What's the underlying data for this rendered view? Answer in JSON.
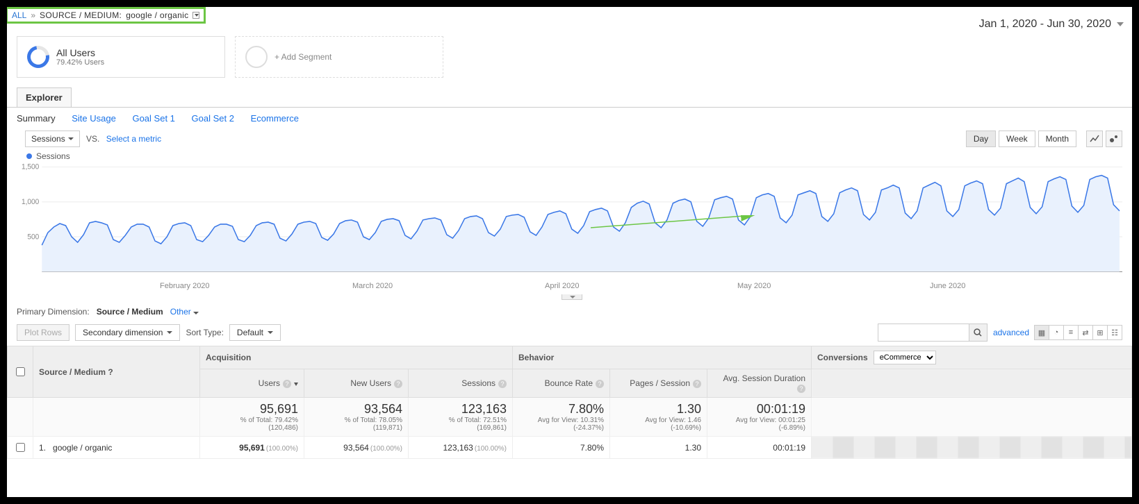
{
  "breadcrumb": {
    "all": "ALL",
    "label": "SOURCE / MEDIUM:",
    "value": "google / organic"
  },
  "dateRange": "Jan 1, 2020 - Jun 30, 2020",
  "segments": {
    "primary": {
      "title": "All Users",
      "sub": "79.42% Users"
    },
    "add": "+ Add Segment"
  },
  "tabs": {
    "explorer": "Explorer"
  },
  "subtabs": {
    "summary": "Summary",
    "siteUsage": "Site Usage",
    "goal1": "Goal Set 1",
    "goal2": "Goal Set 2",
    "ecom": "Ecommerce"
  },
  "chartBar": {
    "metric": "Sessions",
    "vs": "VS.",
    "selectMetric": "Select a metric",
    "day": "Day",
    "week": "Week",
    "month": "Month"
  },
  "chartLegend": "Sessions",
  "chart_data": {
    "type": "line",
    "title": "Sessions",
    "ylabel": "",
    "xlabel": "",
    "ylim": [
      0,
      1500
    ],
    "yticks": [
      500,
      1000,
      1500
    ],
    "xticks": [
      "February 2020",
      "March 2020",
      "April 2020",
      "May 2020",
      "June 2020"
    ],
    "series": [
      {
        "name": "Sessions",
        "color": "#3b78e7",
        "values": [
          380,
          560,
          640,
          690,
          660,
          500,
          420,
          530,
          700,
          720,
          700,
          670,
          460,
          420,
          520,
          640,
          680,
          680,
          640,
          440,
          400,
          500,
          660,
          690,
          700,
          660,
          460,
          430,
          520,
          640,
          680,
          680,
          650,
          460,
          430,
          520,
          660,
          700,
          710,
          680,
          480,
          440,
          540,
          680,
          710,
          720,
          690,
          490,
          450,
          540,
          690,
          730,
          740,
          710,
          500,
          460,
          560,
          720,
          750,
          760,
          730,
          520,
          470,
          580,
          740,
          760,
          770,
          740,
          530,
          480,
          590,
          760,
          790,
          800,
          760,
          560,
          510,
          610,
          790,
          810,
          820,
          780,
          570,
          520,
          640,
          820,
          850,
          870,
          830,
          610,
          550,
          660,
          860,
          890,
          910,
          870,
          640,
          580,
          700,
          920,
          980,
          1010,
          970,
          700,
          630,
          740,
          980,
          1020,
          1040,
          1000,
          720,
          650,
          770,
          1030,
          1060,
          1080,
          1040,
          740,
          670,
          790,
          1060,
          1100,
          1120,
          1080,
          770,
          700,
          810,
          1100,
          1130,
          1160,
          1120,
          790,
          720,
          830,
          1130,
          1170,
          1200,
          1160,
          820,
          740,
          850,
          1170,
          1200,
          1240,
          1200,
          840,
          760,
          870,
          1200,
          1240,
          1280,
          1230,
          870,
          790,
          890,
          1230,
          1270,
          1300,
          1260,
          890,
          810,
          910,
          1260,
          1300,
          1340,
          1290,
          920,
          830,
          930,
          1290,
          1330,
          1360,
          1320,
          940,
          850,
          950,
          1320,
          1360,
          1380,
          1340,
          960,
          870
        ]
      }
    ]
  },
  "dimRow": {
    "label": "Primary Dimension:",
    "value": "Source / Medium",
    "other": "Other"
  },
  "toolbar2": {
    "plotRows": "Plot Rows",
    "secondary": "Secondary dimension",
    "sortType": "Sort Type:",
    "default": "Default",
    "advanced": "advanced"
  },
  "table": {
    "groupHeaders": {
      "sourceMedium": "Source / Medium",
      "acquisition": "Acquisition",
      "behavior": "Behavior",
      "conversions": "Conversions",
      "conversionsSelect": "eCommerce"
    },
    "cols": {
      "users": "Users",
      "newUsers": "New Users",
      "sessions": "Sessions",
      "bounceRate": "Bounce Rate",
      "pagesSession": "Pages / Session",
      "avgDuration": "Avg. Session Duration"
    },
    "summary": {
      "users": {
        "big": "95,691",
        "sub1": "% of Total: 79.42%",
        "sub2": "(120,486)"
      },
      "newUsers": {
        "big": "93,564",
        "sub1": "% of Total: 78.05%",
        "sub2": "(119,871)"
      },
      "sessions": {
        "big": "123,163",
        "sub1": "% of Total: 72.51%",
        "sub2": "(169,861)"
      },
      "bounceRate": {
        "big": "7.80%",
        "sub1": "Avg for View: 10.31%",
        "sub2": "(-24.37%)"
      },
      "pagesSession": {
        "big": "1.30",
        "sub1": "Avg for View: 1.46",
        "sub2": "(-10.69%)"
      },
      "avgDuration": {
        "big": "00:01:19",
        "sub1": "Avg for View: 00:01:25",
        "sub2": "(-6.89%)"
      }
    },
    "rows": [
      {
        "index": "1.",
        "name": "google / organic",
        "users": "95,691",
        "usersPct": "(100.00%)",
        "newUsers": "93,564",
        "newUsersPct": "(100.00%)",
        "sessions": "123,163",
        "sessionsPct": "(100.00%)",
        "bounceRate": "7.80%",
        "pagesSession": "1.30",
        "avgDuration": "00:01:19"
      }
    ]
  }
}
